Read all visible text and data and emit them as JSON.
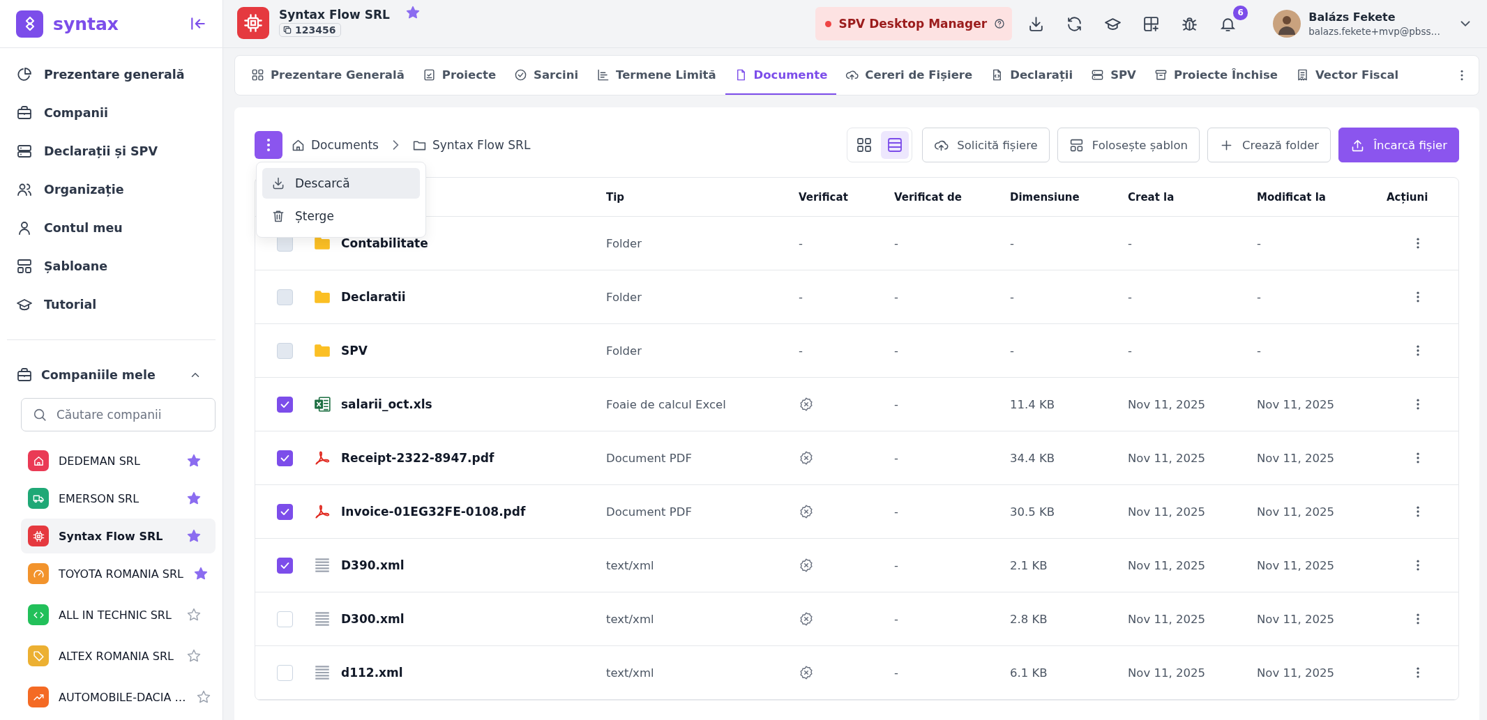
{
  "brand": {
    "name": "syntax"
  },
  "nav": [
    {
      "label": "Prezentare generală"
    },
    {
      "label": "Companii"
    },
    {
      "label": "Declarații și SPV"
    },
    {
      "label": "Organizație"
    },
    {
      "label": "Contul meu"
    },
    {
      "label": "Șabloane"
    },
    {
      "label": "Tutorial"
    }
  ],
  "companies_section": {
    "title": "Companiile mele",
    "expanded": true,
    "search": {
      "placeholder": "Căutare companii"
    },
    "items": [
      {
        "name": "DEDEMAN SRL",
        "color": "#ea3a55",
        "starred": true,
        "selected": false
      },
      {
        "name": "EMERSON SRL",
        "color": "#1fa876",
        "starred": true,
        "selected": false
      },
      {
        "name": "Syntax Flow SRL",
        "color": "#e5393f",
        "starred": true,
        "selected": true
      },
      {
        "name": "TOYOTA ROMANIA SRL",
        "color": "#f2932c",
        "starred": true,
        "selected": false
      },
      {
        "name": "ALL IN TECHNIC SRL",
        "color": "#22c05a",
        "starred": false,
        "selected": false
      },
      {
        "name": "ALTEX ROMANIA SRL",
        "color": "#ecb032",
        "starred": false,
        "selected": false
      },
      {
        "name": "AUTOMOBILE-DACIA …",
        "color": "#f46a24",
        "starred": false,
        "selected": false
      }
    ]
  },
  "header": {
    "company": "Syntax Flow SRL",
    "company_id": "123456",
    "starred": true,
    "spv_badge": "SPV Desktop Manager",
    "notifications": "6",
    "user": {
      "name": "Balázs Fekete",
      "email": "balazs.fekete+mvp@pbss…"
    }
  },
  "tabs": [
    {
      "label": "Prezentare Generală",
      "selected": false
    },
    {
      "label": "Proiecte",
      "selected": false
    },
    {
      "label": "Sarcini",
      "selected": false
    },
    {
      "label": "Termene Limită",
      "selected": false
    },
    {
      "label": "Documente",
      "selected": true
    },
    {
      "label": "Cereri de Fișiere",
      "selected": false
    },
    {
      "label": "Declarații",
      "selected": false
    },
    {
      "label": "SPV",
      "selected": false
    },
    {
      "label": "Proiecte Închise",
      "selected": false
    },
    {
      "label": "Vector Fiscal",
      "selected": false
    }
  ],
  "breadcrumb": [
    "Documents",
    "Syntax Flow SRL"
  ],
  "view_toggle": [
    {
      "kind": "grid",
      "selected": false
    },
    {
      "kind": "list",
      "selected": true
    }
  ],
  "actions": [
    {
      "label": "Solicită fișiere",
      "primary": false
    },
    {
      "label": "Folosește șablon",
      "primary": false
    },
    {
      "label": "Crează folder",
      "primary": false
    },
    {
      "label": "Încarcă fișier",
      "primary": true
    }
  ],
  "menu": [
    {
      "label": "Descarcă",
      "selected": true
    },
    {
      "label": "Șterge",
      "selected": false
    }
  ],
  "table": {
    "columns": [
      "Tip",
      "Verificat",
      "Verificat de",
      "Dimensiune",
      "Creat la",
      "Modificat la",
      "Acțiuni"
    ],
    "rows": [
      {
        "kind": "folder",
        "name": "Contabilitate",
        "type": "Folder",
        "verified": "-",
        "verified_by": "-",
        "size": "-",
        "created": "-",
        "modified": "-",
        "checked": false,
        "disabled": true
      },
      {
        "kind": "folder",
        "name": "Declaratii",
        "type": "Folder",
        "verified": "-",
        "verified_by": "-",
        "size": "-",
        "created": "-",
        "modified": "-",
        "checked": false,
        "disabled": true
      },
      {
        "kind": "folder",
        "name": "SPV",
        "type": "Folder",
        "verified": "-",
        "verified_by": "-",
        "size": "-",
        "created": "-",
        "modified": "-",
        "checked": false,
        "disabled": true
      },
      {
        "kind": "excel",
        "name": "salarii_oct.xls",
        "type": "Foaie de calcul Excel",
        "verified": false,
        "verified_by": "-",
        "size": "11.4 KB",
        "created": "Nov 11, 2025",
        "modified": "Nov 11, 2025",
        "checked": true,
        "disabled": false
      },
      {
        "kind": "pdf",
        "name": "Receipt-2322-8947.pdf",
        "type": "Document PDF",
        "verified": false,
        "verified_by": "-",
        "size": "34.4 KB",
        "created": "Nov 11, 2025",
        "modified": "Nov 11, 2025",
        "checked": true,
        "disabled": false
      },
      {
        "kind": "pdf",
        "name": "Invoice-01EG32FE-0108.pdf",
        "type": "Document PDF",
        "verified": false,
        "verified_by": "-",
        "size": "30.5 KB",
        "created": "Nov 11, 2025",
        "modified": "Nov 11, 2025",
        "checked": true,
        "disabled": false
      },
      {
        "kind": "text",
        "name": "D390.xml",
        "type": "text/xml",
        "verified": false,
        "verified_by": "-",
        "size": "2.1 KB",
        "created": "Nov 11, 2025",
        "modified": "Nov 11, 2025",
        "checked": true,
        "disabled": false
      },
      {
        "kind": "text",
        "name": "D300.xml",
        "type": "text/xml",
        "verified": false,
        "verified_by": "-",
        "size": "2.8 KB",
        "created": "Nov 11, 2025",
        "modified": "Nov 11, 2025",
        "checked": false,
        "disabled": false
      },
      {
        "kind": "text",
        "name": "d112.xml",
        "type": "text/xml",
        "verified": false,
        "verified_by": "-",
        "size": "6.1 KB",
        "created": "Nov 11, 2025",
        "modified": "Nov 11, 2025",
        "checked": false,
        "disabled": false
      }
    ]
  }
}
